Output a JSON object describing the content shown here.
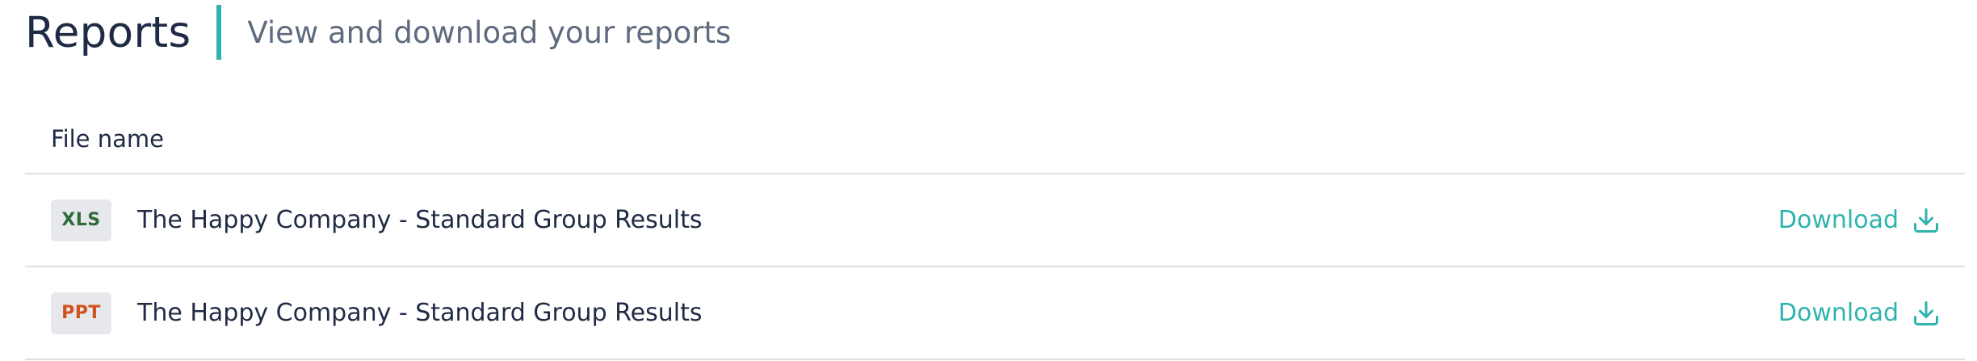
{
  "header": {
    "title": "Reports",
    "subtitle": "View and download your reports"
  },
  "table": {
    "column_file_name": "File name",
    "rows": [
      {
        "type": "XLS",
        "type_color": "#2f6b3a",
        "name": "The Happy Company - Standard Group Results",
        "action": "Download"
      },
      {
        "type": "PPT",
        "type_color": "#d2521d",
        "name": "The Happy Company - Standard Group Results",
        "action": "Download"
      }
    ]
  },
  "colors": {
    "accent": "#2fb3ad",
    "text": "#1f2a44",
    "muted": "#5e6b7e",
    "border": "#dedfe2",
    "badge_bg": "#e6e8eb"
  },
  "icons": {
    "download": "download-icon"
  }
}
